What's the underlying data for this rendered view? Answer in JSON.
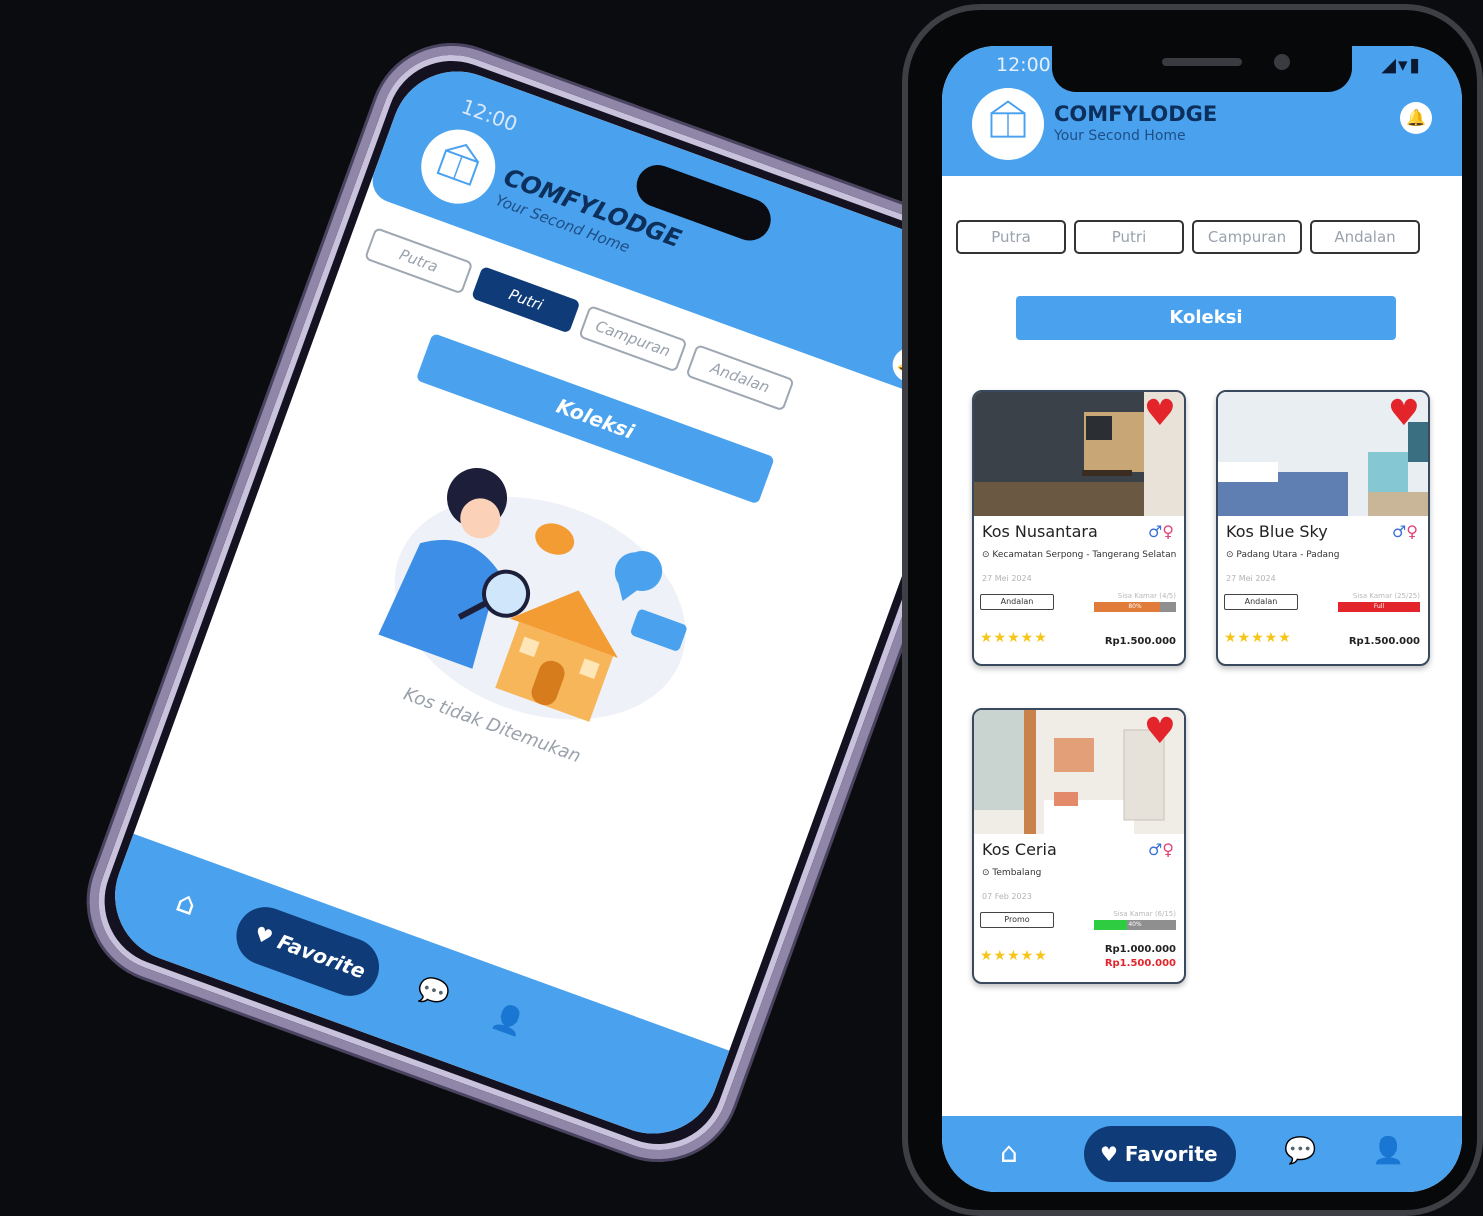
{
  "status_time": "12:00",
  "status_icons": "◢▾▮",
  "brand": {
    "name": "COMFYLODGE",
    "tagline": "Your Second Home"
  },
  "icons": {
    "bell": "🔔",
    "home": "⌂",
    "heart": "♥",
    "chat": "💬",
    "user": "👤",
    "pin": "⊙",
    "male": "♂",
    "female": "♀"
  },
  "tabs": [
    "Putra",
    "Putri",
    "Campuran",
    "Andalan"
  ],
  "phone1": {
    "active_tab": "Putri",
    "collection_button": "Koleksi",
    "empty_message": "Kos tidak Ditemukan"
  },
  "phone2": {
    "collection_button": "Koleksi",
    "cards": [
      {
        "title": "Kos Nusantara",
        "location": "Kecamatan Serpong - Tangerang Selatan",
        "date": "27 Mei 2024",
        "badge": "Andalan",
        "room_label": "Sisa Kamar (4/5)",
        "bar_text": "80%",
        "bar_fill": 0.8,
        "bar_color": "#e07b39",
        "stars": "★★★★★",
        "price": "Rp1.500.000"
      },
      {
        "title": "Kos Blue Sky",
        "location": "Padang Utara - Padang",
        "date": "27 Mei 2024",
        "badge": "Andalan",
        "room_label": "Sisa Kamar (25/25)",
        "bar_text": "Full",
        "bar_fill": 1.0,
        "bar_color": "#e3242b",
        "stars": "★★★★★",
        "price": "Rp1.500.000"
      },
      {
        "title": "Kos Ceria",
        "location": "Tembalang",
        "date": "07 Feb 2023",
        "badge": "Promo",
        "room_label": "Sisa Kamar (6/15)",
        "bar_text": "40%",
        "bar_fill": 0.4,
        "bar_color": "#2ecc40",
        "stars": "★★★★★",
        "price": "Rp1.000.000",
        "old_price": "Rp1.500.000"
      }
    ]
  },
  "nav": {
    "favorite_label": "Favorite"
  }
}
